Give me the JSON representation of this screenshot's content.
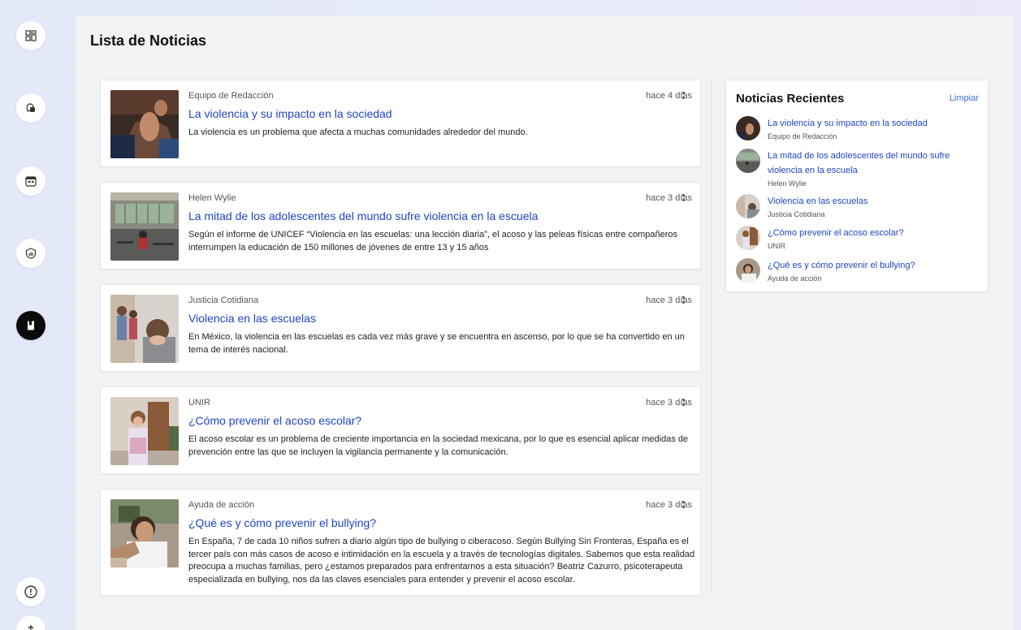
{
  "sidebar": {
    "items": [
      {
        "icon": "dashboard-icon"
      },
      {
        "icon": "chat-icon"
      },
      {
        "icon": "calendar-icon"
      },
      {
        "icon": "analytics-shield-icon"
      },
      {
        "icon": "bookmark-icon",
        "active": true
      }
    ],
    "bottom": [
      {
        "icon": "alert-icon"
      },
      {
        "icon": "upload-icon"
      }
    ]
  },
  "page": {
    "title": "Lista de Noticias"
  },
  "news": [
    {
      "source": "Equipo de Redacción",
      "time": "hace 4 días",
      "title": "La violencia y su impacto en la sociedad",
      "description": "La violencia es un problema que afecta a muchas comunidades alrededor del mundo."
    },
    {
      "source": "Helen Wylie",
      "time": "hace 3 días",
      "title": "La mitad de los adolescentes del mundo sufre violencia en la escuela",
      "description": "Según el informe de UNICEF “Violencia en las escuelas: una lección diaria”, el acoso y las peleas físicas entre compañeros interrumpen la educación de 150 millones de jóvenes de entre 13 y 15 años"
    },
    {
      "source": "Justicia Cotidiana",
      "time": "hace 3 días",
      "title": "Violencia en las escuelas",
      "description": "En México, la violencia en las escuelas es cada vez más grave y se encuentra en ascenso, por lo que se ha convertido en un tema de interés nacional."
    },
    {
      "source": "UNIR",
      "time": "hace 3 días",
      "title": "¿Cómo prevenir el acoso escolar?",
      "description": "El acoso escolar es un problema de creciente importancia en la sociedad mexicana, por lo que es esencial aplicar medidas de prevención entre las que se incluyen la vigilancia permanente y la comunicación."
    },
    {
      "source": "Ayuda de acción",
      "time": "hace 3 días",
      "title": "¿Qué es y cómo prevenir el bullying?",
      "description": "En España, 7 de cada 10 niños sufren a diario algún tipo de bullying o ciberacoso. Según Bullying Sin Fronteras, España es el tercer país con más casos de acoso e intimidación en la escuela y a través de tecnologías digitales. Sabemos que esta realidad preocupa a muchas familias, pero ¿estamos preparados para enfrentarnos a esta situación? Beatriz Cazurro, psicoterapeuta especializada en bullying, nos da las claves esenciales para entender y prevenir el acoso escolar."
    }
  ],
  "recent": {
    "title": "Noticias Recientes",
    "clear_label": "Limpiar",
    "items": [
      {
        "title": "La violencia y su impacto en la sociedad",
        "source": "Equipo de Redacción"
      },
      {
        "title": "La mitad de los adolescentes del mundo sufre violencia en la escuela",
        "source": "Helen Wylie"
      },
      {
        "title": "Violencia en las escuelas",
        "source": "Justicia Cotidiana"
      },
      {
        "title": "¿Cómo prevenir el acoso escolar?",
        "source": "UNIR"
      },
      {
        "title": "¿Qué es y cómo prevenir el bullying?",
        "source": "Ayuda de acción"
      }
    ]
  },
  "colors": {
    "link": "#1f45c4",
    "clear": "#3b6fd6",
    "active_nav": "#0b0b0b"
  }
}
